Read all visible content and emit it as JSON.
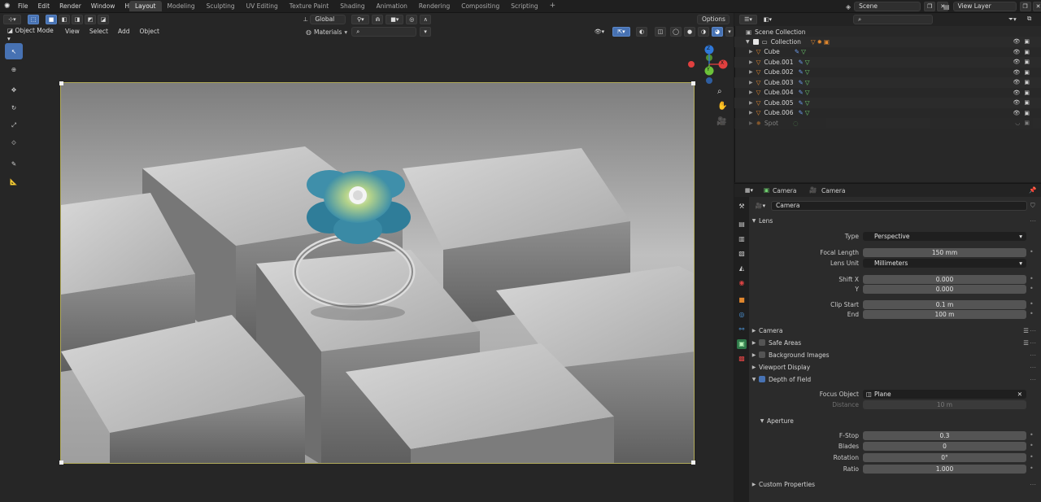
{
  "menubar": {
    "items": [
      "File",
      "Edit",
      "Render",
      "Window",
      "Help"
    ],
    "workspaces": [
      "Layout",
      "Modeling",
      "Sculpting",
      "UV Editing",
      "Texture Paint",
      "Shading",
      "Animation",
      "Rendering",
      "Compositing",
      "Scripting"
    ],
    "active_workspace": "Layout",
    "add_tab": "+",
    "scene": "Scene",
    "view_layer": "View Layer"
  },
  "viewport": {
    "transform_orientation": "Global",
    "options": "Options",
    "mode": "Object Mode",
    "menus": [
      "View",
      "Select",
      "Add",
      "Object"
    ],
    "shading_dropdown": "Materials",
    "nav_gizmo": {
      "x": "X",
      "y": "Y",
      "z": "Z"
    }
  },
  "outliner": {
    "search_placeholder": "",
    "scene_collection": "Scene Collection",
    "collection": "Collection",
    "objects": [
      "Cube",
      "Cube.001",
      "Cube.002",
      "Cube.003",
      "Cube.004",
      "Cube.005",
      "Cube.006",
      "Spot"
    ]
  },
  "properties": {
    "breadcrumb_object": "Camera",
    "breadcrumb_data": "Camera",
    "data_name": "Camera",
    "lens_section": "Lens",
    "type_label": "Type",
    "type_value": "Perspective",
    "focal_length_label": "Focal Length",
    "focal_length_value": "150 mm",
    "lens_unit_label": "Lens Unit",
    "lens_unit_value": "Millimeters",
    "shift_x_label": "Shift X",
    "shift_x_value": "0.000",
    "shift_y_label": "Y",
    "shift_y_value": "0.000",
    "clip_start_label": "Clip Start",
    "clip_start_value": "0.1 m",
    "clip_end_label": "End",
    "clip_end_value": "100 m",
    "camera_section": "Camera",
    "safe_areas_section": "Safe Areas",
    "background_images_section": "Background Images",
    "viewport_display_section": "Viewport Display",
    "dof_section": "Depth of Field",
    "focus_object_label": "Focus Object",
    "focus_object_value": "Plane",
    "distance_label": "Distance",
    "distance_value": "10 m",
    "aperture_section": "Aperture",
    "fstop_label": "F-Stop",
    "fstop_value": "0.3",
    "blades_label": "Blades",
    "blades_value": "0",
    "rotation_label": "Rotation",
    "rotation_value": "0°",
    "ratio_label": "Ratio",
    "ratio_value": "1.000",
    "custom_props_section": "Custom Properties"
  },
  "colors": {
    "accent_blue": "#4772b3",
    "object_orange": "#e0872e",
    "mesh_green": "#6fcf6f",
    "camera_border": "#b1aa5a"
  }
}
